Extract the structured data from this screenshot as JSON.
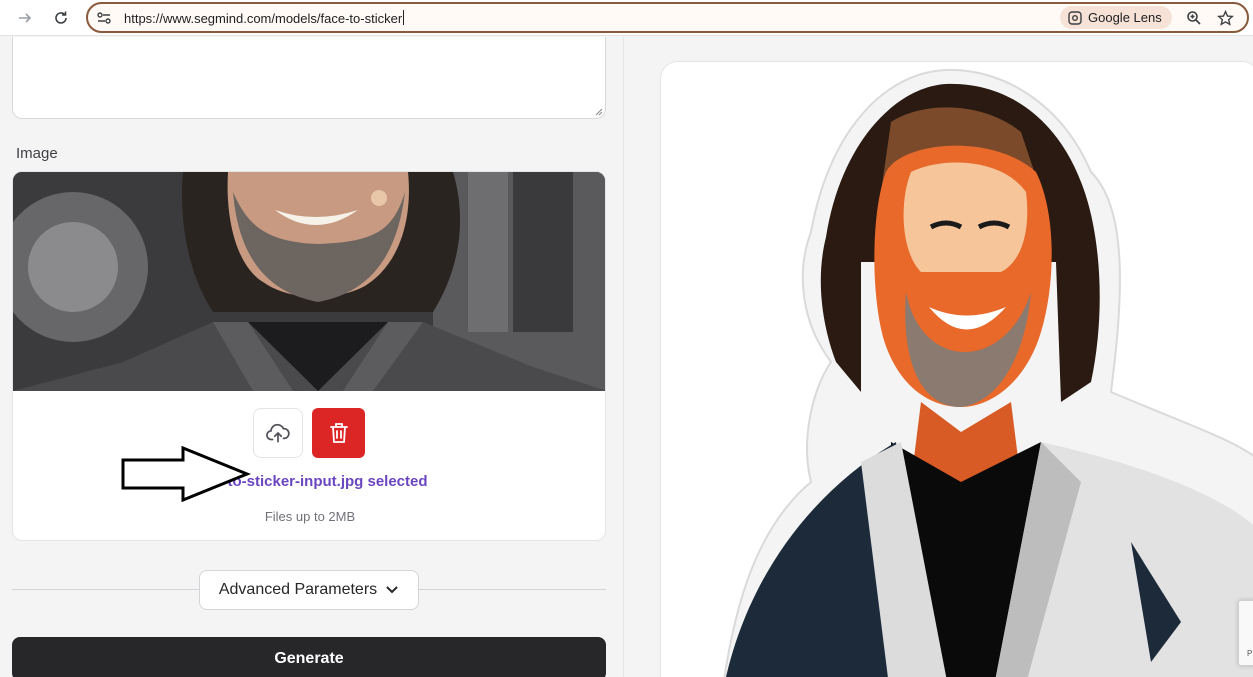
{
  "browser": {
    "url": "https://www.segmind.com/models/face-to-sticker",
    "lens_label": "Google Lens"
  },
  "form": {
    "image_label": "Image",
    "file_selected": "face-to-sticker-input.jpg selected",
    "file_hint": "Files up to 2MB",
    "advanced_label": "Advanced Parameters",
    "generate_label": "Generate"
  },
  "recaptcha": {
    "text": "P"
  },
  "colors": {
    "accent_purple": "#6b46c1",
    "delete_red": "#dc2626",
    "generate_dark": "#27272a",
    "omnibox_border": "#8a5a3c"
  }
}
